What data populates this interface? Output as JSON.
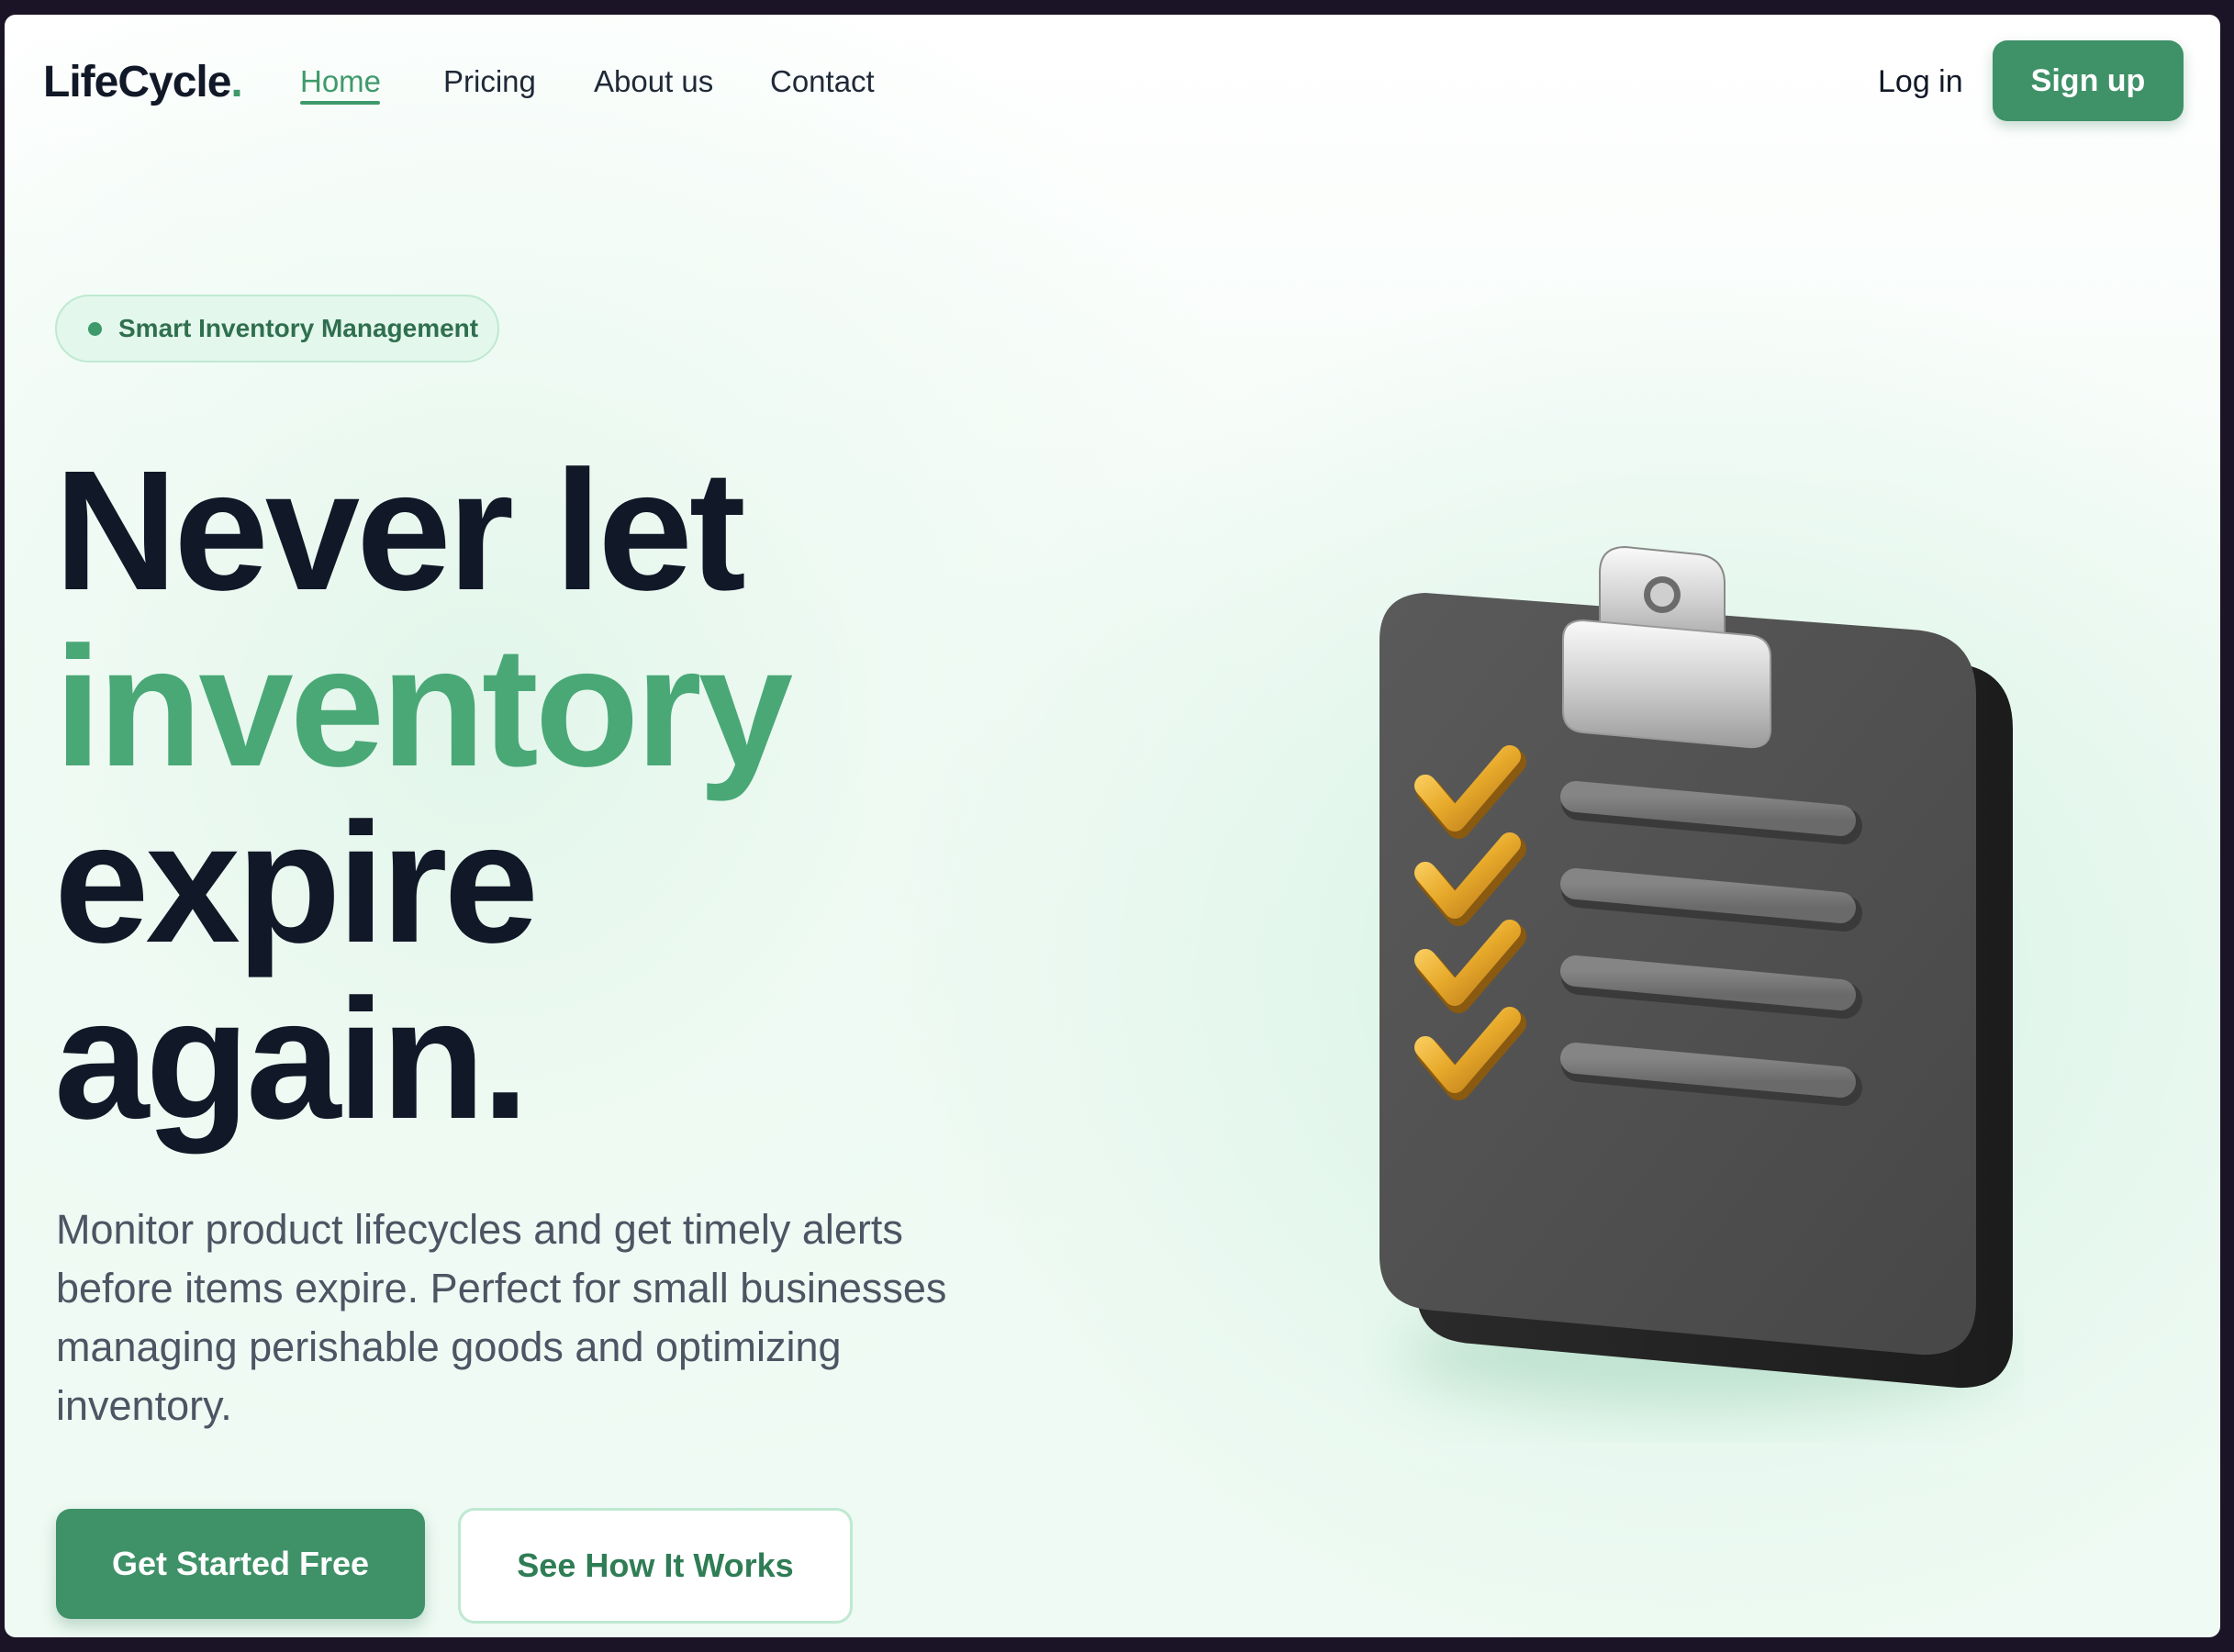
{
  "nav": {
    "logo": "LifeCycle",
    "logo_dot": ".",
    "links": [
      "Home",
      "Pricing",
      "About us",
      "Contact"
    ],
    "active": "Home",
    "login": "Log in",
    "signup": "Sign up"
  },
  "hero": {
    "badge": "Smart Inventory Management",
    "headline": [
      "Never let",
      "inventory",
      "expire",
      "again."
    ],
    "highlight": "inventory",
    "description": "Monitor product lifecycles and get timely alerts before items expire. Perfect for small businesses managing perishable goods and optimizing inventory.",
    "cta_primary": "Get Started Free",
    "cta_secondary": "See How It Works"
  },
  "illustration": {
    "icon": "clipboard-checklist-icon",
    "checked_items": 4
  },
  "colors": {
    "brand": "#3f9168",
    "accent_text": "#4aa877",
    "heading": "#111827",
    "body_text": "#4b5563",
    "badge_bg": "#e3f7ec"
  }
}
